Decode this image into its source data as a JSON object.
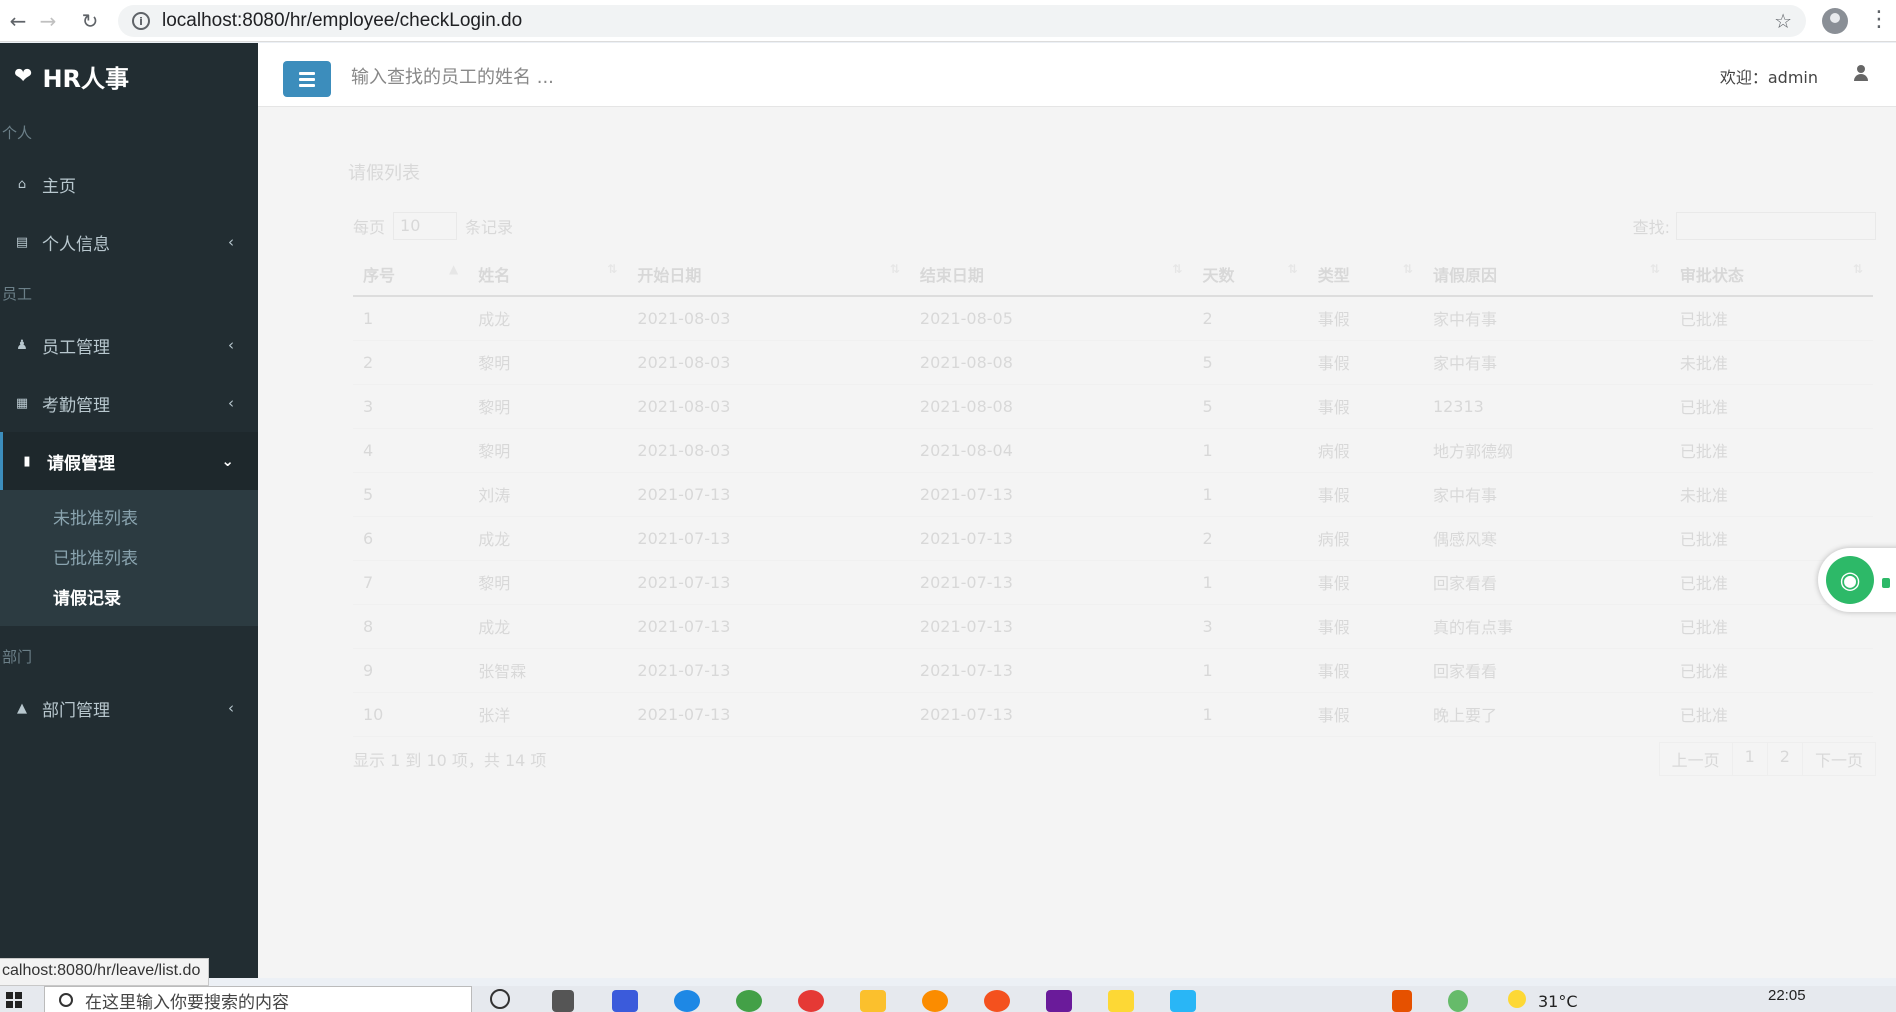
{
  "browser": {
    "url": "localhost:8080/hr/employee/checkLogin.do",
    "status_url": "calhost:8080/hr/leave/list.do"
  },
  "sidebar": {
    "logo": "HR人事",
    "sections": {
      "personal": "个人",
      "employee": "员工",
      "department": "部门"
    },
    "items": {
      "home": "主页",
      "personal_info": "个人信息",
      "employee_mgmt": "员工管理",
      "attendance_mgmt": "考勤管理",
      "leave_mgmt": "请假管理",
      "dept_mgmt": "部门管理"
    },
    "submenu": {
      "unapproved": "未批准列表",
      "approved": "已批准列表",
      "records": "请假记录"
    }
  },
  "header": {
    "search_placeholder": "输入查找的员工的姓名 ...",
    "welcome": "欢迎：admin"
  },
  "leave_list": {
    "title": "请假列表",
    "length_prefix": "每页",
    "length_value": "10",
    "length_suffix": "条记录",
    "search_label": "查找:",
    "columns": [
      "序号",
      "姓名",
      "开始日期",
      "结束日期",
      "天数",
      "类型",
      "请假原因",
      "审批状态"
    ],
    "rows": [
      [
        "1",
        "成龙",
        "2021-08-03",
        "2021-08-05",
        "2",
        "事假",
        "家中有事",
        "已批准"
      ],
      [
        "2",
        "黎明",
        "2021-08-03",
        "2021-08-08",
        "5",
        "事假",
        "家中有事",
        "未批准"
      ],
      [
        "3",
        "黎明",
        "2021-08-03",
        "2021-08-08",
        "5",
        "事假",
        "12313",
        "已批准"
      ],
      [
        "4",
        "黎明",
        "2021-08-03",
        "2021-08-04",
        "1",
        "病假",
        "地方郭德纲",
        "已批准"
      ],
      [
        "5",
        "刘涛",
        "2021-07-13",
        "2021-07-13",
        "1",
        "事假",
        "家中有事",
        "未批准"
      ],
      [
        "6",
        "成龙",
        "2021-07-13",
        "2021-07-13",
        "2",
        "病假",
        "偶感风寒",
        "已批准"
      ],
      [
        "7",
        "黎明",
        "2021-07-13",
        "2021-07-13",
        "1",
        "事假",
        "回家看看",
        "已批准"
      ],
      [
        "8",
        "成龙",
        "2021-07-13",
        "2021-07-13",
        "3",
        "事假",
        "真的有点事",
        "已批准"
      ],
      [
        "9",
        "张智霖",
        "2021-07-13",
        "2021-07-13",
        "1",
        "事假",
        "回家看看",
        "已批准"
      ],
      [
        "10",
        "张洋",
        "2021-07-13",
        "2021-07-13",
        "1",
        "事假",
        "晚上要了",
        "已批准"
      ]
    ],
    "info": "显示 1 到 10 项，共 14 项",
    "pager": {
      "prev": "上一页",
      "p1": "1",
      "p2": "2",
      "next": "下一页"
    }
  },
  "taskbar": {
    "search_placeholder": "在这里输入你要搜索的内容",
    "temperature": "31°C",
    "time": "22:05"
  },
  "colors": {
    "sidebar_bg": "#222d32",
    "accent": "#3c8dbc",
    "wifi_green": "#2db968"
  }
}
